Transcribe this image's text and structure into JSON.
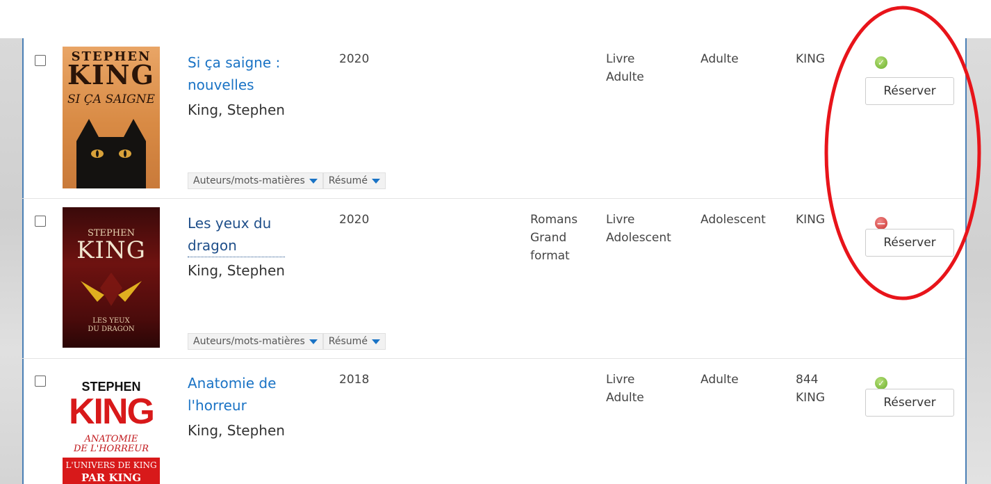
{
  "results": [
    {
      "title": "Si ça saigne : nouvelles",
      "author": "King, Stephen",
      "year": "2020",
      "genre": "",
      "doc_type": "Livre Adulte",
      "public": "Adulte",
      "cote": "KING",
      "status": "available",
      "status_color": "#6aae2a",
      "reserve_label": "Réserver",
      "cover": {
        "line1": "STEPHEN",
        "line2": "KING",
        "line3": "SI ÇA SAIGNE"
      },
      "toggle_authors": "Auteurs/mots-matières",
      "toggle_summary": "Résumé"
    },
    {
      "title": "Les yeux du dragon",
      "author": "King, Stephen",
      "year": "2020",
      "genre": "Romans Grand format",
      "doc_type": "Livre Adolescent",
      "public": "Adolescent",
      "cote": "KING",
      "status": "unavailable",
      "status_color": "#c9302c",
      "reserve_label": "Réserver",
      "cover": {
        "line1": "STEPHEN",
        "line2": "KING",
        "line3": "LES YEUX",
        "line4": "DU DRAGON"
      },
      "toggle_authors": "Auteurs/mots-matières",
      "toggle_summary": "Résumé"
    },
    {
      "title": "Anatomie de l'horreur",
      "author": "King, Stephen",
      "year": "2018",
      "genre": "",
      "doc_type": "Livre Adulte",
      "public": "Adulte",
      "cote": "844 KING",
      "status": "available",
      "status_color": "#6aae2a",
      "reserve_label": "Réserver",
      "cover": {
        "line1": "STEPHEN",
        "line2": "KING",
        "line3": "ANATOMIE",
        "line4": "DE L'HORREUR",
        "line5": "L'UNIVERS DE KING",
        "line6": "PAR KING"
      }
    }
  ],
  "annotation": {
    "shape": "ellipse",
    "color": "#e8141a"
  },
  "icons": {
    "available": "check-circle-icon",
    "unavailable": "minus-circle-icon",
    "toggle": "caret-down-icon"
  }
}
